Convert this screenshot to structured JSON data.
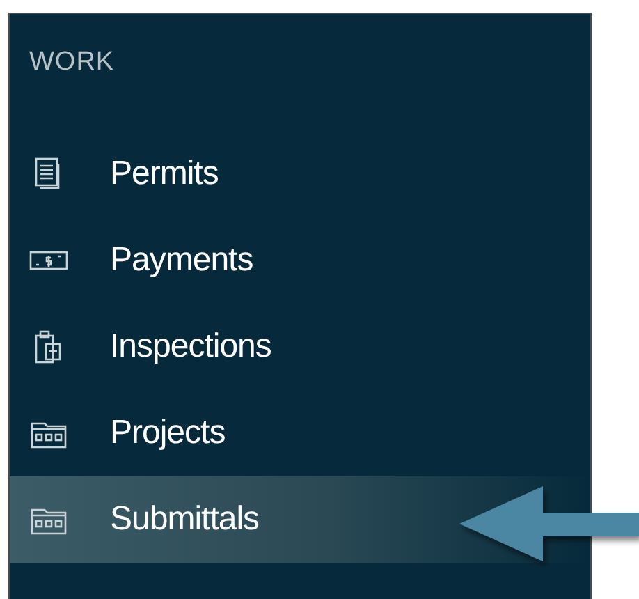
{
  "sidebar": {
    "section_title": "WORK",
    "items": [
      {
        "label": "Permits",
        "kind": "document",
        "selected": false
      },
      {
        "label": "Payments",
        "kind": "money",
        "selected": false
      },
      {
        "label": "Inspections",
        "kind": "clipboard",
        "selected": false
      },
      {
        "label": "Projects",
        "kind": "folder",
        "selected": false
      },
      {
        "label": "Submittals",
        "kind": "folder",
        "selected": true
      }
    ]
  }
}
